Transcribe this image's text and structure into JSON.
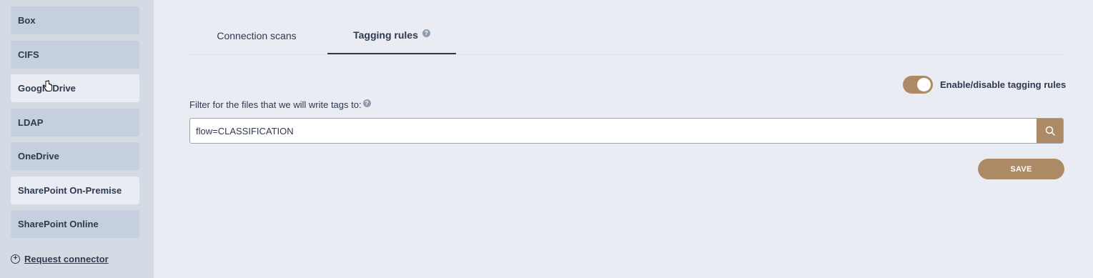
{
  "sidebar": {
    "items": [
      {
        "label": "Box"
      },
      {
        "label": "CIFS"
      },
      {
        "label": "Google Drive"
      },
      {
        "label": "LDAP"
      },
      {
        "label": "OneDrive"
      },
      {
        "label": "SharePoint On-Premise"
      },
      {
        "label": "SharePoint Online"
      }
    ],
    "request_connector": "Request connector"
  },
  "tabs": [
    {
      "label": "Connection scans"
    },
    {
      "label": "Tagging rules",
      "active": true
    }
  ],
  "help_icon": "?",
  "toggle": {
    "label": "Enable/disable tagging rules",
    "enabled": true
  },
  "filter": {
    "label": "Filter for the files that we will write tags to:",
    "value": "flow=CLASSIFICATION"
  },
  "save_label": "SAVE",
  "colors": {
    "accent": "#ad8a66",
    "text": "#2e3a4e",
    "background": "#e9ecf2",
    "sidebar": "#d5dbe5"
  }
}
